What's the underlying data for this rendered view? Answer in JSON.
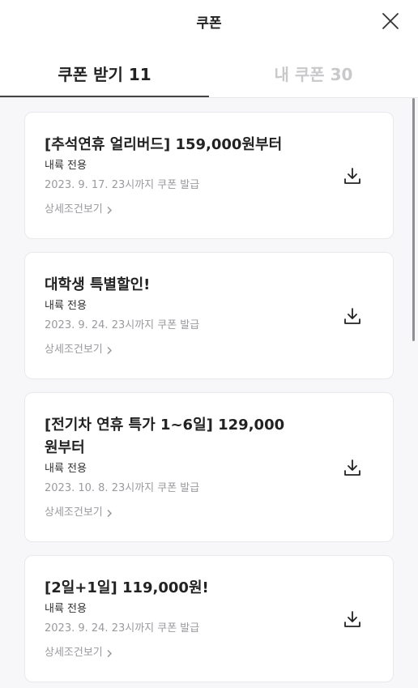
{
  "header": {
    "title": "쿠폰",
    "close_icon": "close-icon"
  },
  "tabs": [
    {
      "label": "쿠폰 받기 11",
      "active": true
    },
    {
      "label": "내 쿠폰 30",
      "active": false
    }
  ],
  "colors": {
    "accent": "#444444",
    "inactive_tab": "#c9c9cc",
    "muted_text": "#9a9a9f",
    "list_bg": "#f7f7f9"
  },
  "coupons": [
    {
      "title": "[추석연휴 얼리버드] 159,000원부터",
      "scope": "내륙 전용",
      "deadline": "2023. 9. 17. 23시까지 쿠폰 발급",
      "detail_label": "상세조건보기",
      "icon": "download-icon"
    },
    {
      "title": "대학생 특별할인!",
      "scope": "내륙 전용",
      "deadline": "2023. 9. 24. 23시까지 쿠폰 발급",
      "detail_label": "상세조건보기",
      "icon": "download-icon"
    },
    {
      "title_line1": "[전기차 연휴 특가 1~6일] 129,000",
      "title_line2": "원부터",
      "scope": "내륙 전용",
      "deadline": "2023. 10. 8. 23시까지 쿠폰 발급",
      "detail_label": "상세조건보기",
      "icon": "download-icon"
    },
    {
      "title": "[2일+1일] 119,000원!",
      "scope": "내륙 전용",
      "deadline": "2023. 9. 24. 23시까지 쿠폰 발급",
      "detail_label": "상세조건보기",
      "icon": "download-icon"
    }
  ]
}
